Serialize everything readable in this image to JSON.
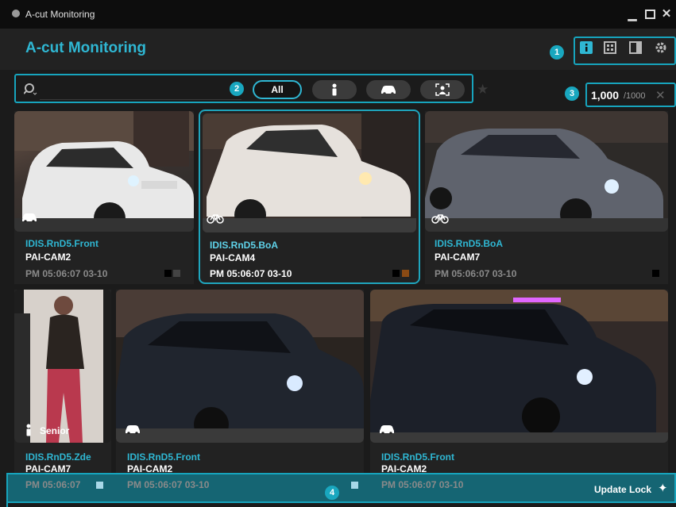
{
  "window": {
    "title": "A-cut Monitoring",
    "controls": [
      "minimize",
      "maximize",
      "close"
    ]
  },
  "header": {
    "app_title": "A-cut Monitoring",
    "tools": [
      "info-icon",
      "grid-icon",
      "panel-icon",
      "gear-icon"
    ]
  },
  "markers": [
    "1",
    "2",
    "3",
    "4"
  ],
  "search": {
    "placeholder": "",
    "filters": {
      "all_label": "All",
      "others": [
        "person-icon",
        "car-icon",
        "face-icon"
      ]
    }
  },
  "count": {
    "current": "1,000",
    "total": "/1000"
  },
  "cards": [
    {
      "site": "IDIS.RnD5.Front",
      "camera": "PAI-CAM2",
      "time": "PM 05:06:07 03-10",
      "type": "car-icon",
      "selected": false,
      "colors": [
        "#000000",
        "#444444"
      ]
    },
    {
      "site": "IDIS.RnD5.BoA",
      "camera": "PAI-CAM4",
      "time": "PM 05:06:07 03-10",
      "type": "bicycle-icon",
      "selected": true,
      "colors": [
        "#000000",
        "#8a4a14"
      ]
    },
    {
      "site": "IDIS.RnD5.BoA",
      "camera": "PAI-CAM7",
      "time": "PM 05:06:07 03-10",
      "type": "bicycle-icon",
      "selected": false,
      "colors": [
        "#000000"
      ]
    },
    {
      "site": "IDIS.RnD5.Zde",
      "camera": "PAI-CAM7",
      "time": "PM 05:06:07",
      "type": "person-icon",
      "badge": "Senior",
      "selected": false,
      "colors": [
        "#a8d8e8"
      ]
    },
    {
      "site": "IDIS.RnD5.Front",
      "camera": "PAI-CAM2",
      "time": "PM 05:06:07 03-10",
      "type": "car-icon",
      "selected": false,
      "colors": [
        "#000000",
        "#a8d8e8"
      ]
    },
    {
      "site": "IDIS.RnD5.Front",
      "camera": "PAI-CAM2",
      "time": "PM 05:06:07 03-10",
      "type": "car-icon",
      "selected": false,
      "colors": []
    }
  ],
  "footer": {
    "update_label": "Update Lock"
  }
}
